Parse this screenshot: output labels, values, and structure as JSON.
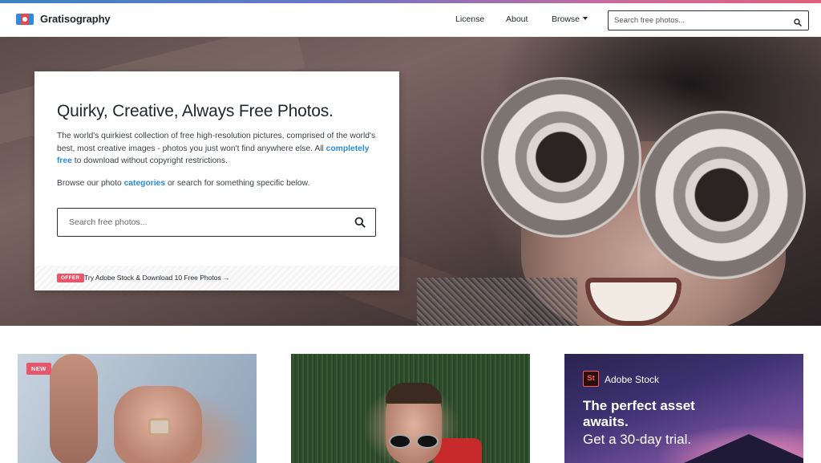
{
  "brand": {
    "name": "Gratisography"
  },
  "colors": {
    "accent_link": "#2a8bd8",
    "badge": "#e8566c",
    "brand_red": "#e5484d",
    "brand_blue": "#2f8be0"
  },
  "nav": {
    "license": "License",
    "about": "About",
    "browse": "Browse"
  },
  "header_search": {
    "placeholder": "Search free photos...",
    "icon": "search-icon"
  },
  "hero": {
    "title": "Quirky, Creative, Always Free Photos.",
    "desc_before": "The world's quirkiest collection of free high-resolution pictures, comprised of the world's best, most creative images - photos you just won't find anywhere else. All ",
    "desc_link": "completely free",
    "desc_after": " to download without copyright restrictions.",
    "browse_before": "Browse our photo ",
    "browse_link": "categories",
    "browse_after": " or search for something specific below.",
    "search_placeholder": "Search free photos...",
    "offer_badge": "OFFER",
    "offer_text": "Try Adobe Stock & Download 10 Free Photos"
  },
  "tiles": {
    "new_badge": "NEW",
    "adobe": {
      "logo_text": "St",
      "name": "Adobe Stock",
      "headline": "The perfect asset awaits.",
      "sub": "Get a 30-day trial."
    }
  }
}
